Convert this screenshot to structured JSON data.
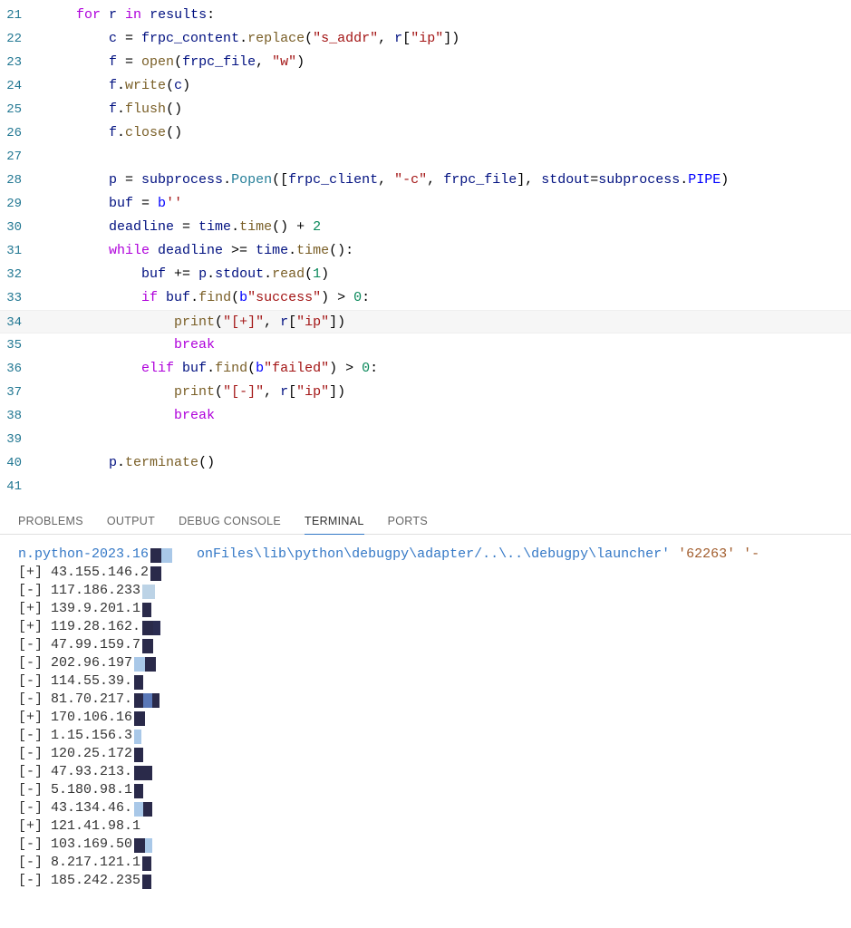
{
  "editor": {
    "highlighted_line": 34,
    "lines": [
      {
        "n": 21,
        "indent": 1,
        "tokens": [
          {
            "t": "for ",
            "c": "tok-kw"
          },
          {
            "t": "r ",
            "c": "tok-var"
          },
          {
            "t": "in ",
            "c": "tok-kw"
          },
          {
            "t": "results",
            "c": "tok-var"
          },
          {
            "t": ":",
            "c": "tok-op"
          }
        ]
      },
      {
        "n": 22,
        "indent": 2,
        "tokens": [
          {
            "t": "c ",
            "c": "tok-var"
          },
          {
            "t": "= ",
            "c": "tok-op"
          },
          {
            "t": "frpc_content",
            "c": "tok-var"
          },
          {
            "t": ".",
            "c": "tok-op"
          },
          {
            "t": "replace",
            "c": "tok-func"
          },
          {
            "t": "(",
            "c": "tok-op"
          },
          {
            "t": "\"s_addr\"",
            "c": "tok-str"
          },
          {
            "t": ", ",
            "c": "tok-op"
          },
          {
            "t": "r",
            "c": "tok-var"
          },
          {
            "t": "[",
            "c": "tok-op"
          },
          {
            "t": "\"ip\"",
            "c": "tok-str"
          },
          {
            "t": "])",
            "c": "tok-op"
          }
        ]
      },
      {
        "n": 23,
        "indent": 2,
        "tokens": [
          {
            "t": "f ",
            "c": "tok-var"
          },
          {
            "t": "= ",
            "c": "tok-op"
          },
          {
            "t": "open",
            "c": "tok-func"
          },
          {
            "t": "(",
            "c": "tok-op"
          },
          {
            "t": "frpc_file",
            "c": "tok-var"
          },
          {
            "t": ", ",
            "c": "tok-op"
          },
          {
            "t": "\"w\"",
            "c": "tok-str"
          },
          {
            "t": ")",
            "c": "tok-op"
          }
        ]
      },
      {
        "n": 24,
        "indent": 2,
        "tokens": [
          {
            "t": "f",
            "c": "tok-var"
          },
          {
            "t": ".",
            "c": "tok-op"
          },
          {
            "t": "write",
            "c": "tok-func"
          },
          {
            "t": "(",
            "c": "tok-op"
          },
          {
            "t": "c",
            "c": "tok-var"
          },
          {
            "t": ")",
            "c": "tok-op"
          }
        ]
      },
      {
        "n": 25,
        "indent": 2,
        "tokens": [
          {
            "t": "f",
            "c": "tok-var"
          },
          {
            "t": ".",
            "c": "tok-op"
          },
          {
            "t": "flush",
            "c": "tok-func"
          },
          {
            "t": "()",
            "c": "tok-op"
          }
        ]
      },
      {
        "n": 26,
        "indent": 2,
        "tokens": [
          {
            "t": "f",
            "c": "tok-var"
          },
          {
            "t": ".",
            "c": "tok-op"
          },
          {
            "t": "close",
            "c": "tok-func"
          },
          {
            "t": "()",
            "c": "tok-op"
          }
        ]
      },
      {
        "n": 27,
        "indent": 2,
        "tokens": []
      },
      {
        "n": 28,
        "indent": 2,
        "tokens": [
          {
            "t": "p ",
            "c": "tok-var"
          },
          {
            "t": "= ",
            "c": "tok-op"
          },
          {
            "t": "subprocess",
            "c": "tok-var"
          },
          {
            "t": ".",
            "c": "tok-op"
          },
          {
            "t": "Popen",
            "c": "tok-class"
          },
          {
            "t": "([",
            "c": "tok-op"
          },
          {
            "t": "frpc_client",
            "c": "tok-var"
          },
          {
            "t": ", ",
            "c": "tok-op"
          },
          {
            "t": "\"-c\"",
            "c": "tok-str"
          },
          {
            "t": ", ",
            "c": "tok-op"
          },
          {
            "t": "frpc_file",
            "c": "tok-var"
          },
          {
            "t": "], ",
            "c": "tok-op"
          },
          {
            "t": "stdout",
            "c": "tok-var"
          },
          {
            "t": "=",
            "c": "tok-op"
          },
          {
            "t": "subprocess",
            "c": "tok-var"
          },
          {
            "t": ".",
            "c": "tok-op"
          },
          {
            "t": "PIPE",
            "c": "tok-const"
          },
          {
            "t": ")",
            "c": "tok-op"
          }
        ]
      },
      {
        "n": 29,
        "indent": 2,
        "tokens": [
          {
            "t": "buf ",
            "c": "tok-var"
          },
          {
            "t": "= ",
            "c": "tok-op"
          },
          {
            "t": "b",
            "c": "tok-const"
          },
          {
            "t": "''",
            "c": "tok-str"
          }
        ]
      },
      {
        "n": 30,
        "indent": 2,
        "tokens": [
          {
            "t": "deadline ",
            "c": "tok-var"
          },
          {
            "t": "= ",
            "c": "tok-op"
          },
          {
            "t": "time",
            "c": "tok-var"
          },
          {
            "t": ".",
            "c": "tok-op"
          },
          {
            "t": "time",
            "c": "tok-func"
          },
          {
            "t": "() + ",
            "c": "tok-op"
          },
          {
            "t": "2",
            "c": "tok-num"
          }
        ]
      },
      {
        "n": 31,
        "indent": 2,
        "tokens": [
          {
            "t": "while ",
            "c": "tok-kw"
          },
          {
            "t": "deadline ",
            "c": "tok-var"
          },
          {
            "t": ">= ",
            "c": "tok-op"
          },
          {
            "t": "time",
            "c": "tok-var"
          },
          {
            "t": ".",
            "c": "tok-op"
          },
          {
            "t": "time",
            "c": "tok-func"
          },
          {
            "t": "():",
            "c": "tok-op"
          }
        ]
      },
      {
        "n": 32,
        "indent": 3,
        "tokens": [
          {
            "t": "buf ",
            "c": "tok-var"
          },
          {
            "t": "+= ",
            "c": "tok-op"
          },
          {
            "t": "p",
            "c": "tok-var"
          },
          {
            "t": ".",
            "c": "tok-op"
          },
          {
            "t": "stdout",
            "c": "tok-var"
          },
          {
            "t": ".",
            "c": "tok-op"
          },
          {
            "t": "read",
            "c": "tok-func"
          },
          {
            "t": "(",
            "c": "tok-op"
          },
          {
            "t": "1",
            "c": "tok-num"
          },
          {
            "t": ")",
            "c": "tok-op"
          }
        ]
      },
      {
        "n": 33,
        "indent": 3,
        "tokens": [
          {
            "t": "if ",
            "c": "tok-kw"
          },
          {
            "t": "buf",
            "c": "tok-var"
          },
          {
            "t": ".",
            "c": "tok-op"
          },
          {
            "t": "find",
            "c": "tok-func"
          },
          {
            "t": "(",
            "c": "tok-op"
          },
          {
            "t": "b",
            "c": "tok-const"
          },
          {
            "t": "\"success\"",
            "c": "tok-str"
          },
          {
            "t": ") > ",
            "c": "tok-op"
          },
          {
            "t": "0",
            "c": "tok-num"
          },
          {
            "t": ":",
            "c": "tok-op"
          }
        ]
      },
      {
        "n": 34,
        "indent": 4,
        "tokens": [
          {
            "t": "print",
            "c": "tok-func"
          },
          {
            "t": "(",
            "c": "tok-op"
          },
          {
            "t": "\"[+]\"",
            "c": "tok-str"
          },
          {
            "t": ", ",
            "c": "tok-op"
          },
          {
            "t": "r",
            "c": "tok-var"
          },
          {
            "t": "[",
            "c": "tok-op"
          },
          {
            "t": "\"ip\"",
            "c": "tok-str"
          },
          {
            "t": "])",
            "c": "tok-op"
          }
        ]
      },
      {
        "n": 35,
        "indent": 4,
        "tokens": [
          {
            "t": "break",
            "c": "tok-kw"
          }
        ]
      },
      {
        "n": 36,
        "indent": 3,
        "tokens": [
          {
            "t": "elif ",
            "c": "tok-kw"
          },
          {
            "t": "buf",
            "c": "tok-var"
          },
          {
            "t": ".",
            "c": "tok-op"
          },
          {
            "t": "find",
            "c": "tok-func"
          },
          {
            "t": "(",
            "c": "tok-op"
          },
          {
            "t": "b",
            "c": "tok-const"
          },
          {
            "t": "\"failed\"",
            "c": "tok-str"
          },
          {
            "t": ") > ",
            "c": "tok-op"
          },
          {
            "t": "0",
            "c": "tok-num"
          },
          {
            "t": ":",
            "c": "tok-op"
          }
        ]
      },
      {
        "n": 37,
        "indent": 4,
        "tokens": [
          {
            "t": "print",
            "c": "tok-func"
          },
          {
            "t": "(",
            "c": "tok-op"
          },
          {
            "t": "\"[-]\"",
            "c": "tok-str"
          },
          {
            "t": ", ",
            "c": "tok-op"
          },
          {
            "t": "r",
            "c": "tok-var"
          },
          {
            "t": "[",
            "c": "tok-op"
          },
          {
            "t": "\"ip\"",
            "c": "tok-str"
          },
          {
            "t": "])",
            "c": "tok-op"
          }
        ]
      },
      {
        "n": 38,
        "indent": 4,
        "tokens": [
          {
            "t": "break",
            "c": "tok-kw"
          }
        ]
      },
      {
        "n": 39,
        "indent": 2,
        "tokens": []
      },
      {
        "n": 40,
        "indent": 2,
        "tokens": [
          {
            "t": "p",
            "c": "tok-var"
          },
          {
            "t": ".",
            "c": "tok-op"
          },
          {
            "t": "terminate",
            "c": "tok-func"
          },
          {
            "t": "()",
            "c": "tok-op"
          }
        ]
      },
      {
        "n": 41,
        "indent": 0,
        "tokens": []
      }
    ]
  },
  "panel": {
    "tabs": [
      {
        "label": "PROBLEMS",
        "active": false
      },
      {
        "label": "OUTPUT",
        "active": false
      },
      {
        "label": "DEBUG CONSOLE",
        "active": false
      },
      {
        "label": "TERMINAL",
        "active": true
      },
      {
        "label": "PORTS",
        "active": false
      }
    ]
  },
  "terminal": {
    "header_segments": [
      {
        "text": "n.python-2023.16",
        "c": "term-path"
      },
      {
        "text": "onFiles\\lib\\python\\debugpy\\adapter/..\\..\\debugpy\\launcher' ",
        "c": "term-path"
      },
      {
        "text": "'62263' '-",
        "c": "term-lit"
      }
    ],
    "header_redact": [
      {
        "w": 12,
        "c": "#2a2a4a"
      },
      {
        "w": 12,
        "c": "#a9c8e8"
      }
    ],
    "rows": [
      {
        "status": "[+]",
        "ip": "43.155.146.2",
        "redact": [
          {
            "w": 12,
            "c": "#2a2a4a"
          }
        ]
      },
      {
        "status": "[-]",
        "ip": "117.186.233",
        "redact": [
          {
            "w": 14,
            "c": "#bcd3e6"
          }
        ]
      },
      {
        "status": "[+]",
        "ip": "139.9.201.1",
        "redact": [
          {
            "w": 10,
            "c": "#2a2a4a"
          }
        ]
      },
      {
        "status": "[+]",
        "ip": "119.28.162.",
        "redact": [
          {
            "w": 12,
            "c": "#2a2a4a"
          },
          {
            "w": 8,
            "c": "#2b2d52"
          }
        ]
      },
      {
        "status": "[-]",
        "ip": "47.99.159.7",
        "redact": [
          {
            "w": 12,
            "c": "#2a2a4a"
          }
        ]
      },
      {
        "status": "[-]",
        "ip": "202.96.197",
        "redact": [
          {
            "w": 12,
            "c": "#a9c8e8"
          },
          {
            "w": 12,
            "c": "#2a2a4a"
          }
        ]
      },
      {
        "status": "[-]",
        "ip": "114.55.39.",
        "redact": [
          {
            "w": 10,
            "c": "#2a2a4a"
          }
        ]
      },
      {
        "status": "[-]",
        "ip": "81.70.217.",
        "redact": [
          {
            "w": 10,
            "c": "#2a2a4a"
          },
          {
            "w": 10,
            "c": "#5a78b8"
          },
          {
            "w": 8,
            "c": "#2a2a4a"
          }
        ]
      },
      {
        "status": "[+]",
        "ip": "170.106.16",
        "redact": [
          {
            "w": 12,
            "c": "#2a2a4a"
          }
        ]
      },
      {
        "status": "[-]",
        "ip": "1.15.156.3",
        "redact": [
          {
            "w": 8,
            "c": "#a9c8e8"
          }
        ]
      },
      {
        "status": "[-]",
        "ip": "120.25.172",
        "redact": [
          {
            "w": 10,
            "c": "#2a2a4a"
          }
        ]
      },
      {
        "status": "[-]",
        "ip": "47.93.213.",
        "redact": [
          {
            "w": 12,
            "c": "#2a2a4a"
          },
          {
            "w": 8,
            "c": "#2a2a4a"
          }
        ]
      },
      {
        "status": "[-]",
        "ip": "5.180.98.1",
        "redact": [
          {
            "w": 10,
            "c": "#2a2a4a"
          }
        ]
      },
      {
        "status": "[-]",
        "ip": "43.134.46.",
        "redact": [
          {
            "w": 10,
            "c": "#a9c8e8"
          },
          {
            "w": 10,
            "c": "#2a2a4a"
          }
        ]
      },
      {
        "status": "[+]",
        "ip": "121.41.98.1",
        "redact": []
      },
      {
        "status": "[-]",
        "ip": "103.169.50",
        "redact": [
          {
            "w": 12,
            "c": "#2a2a4a"
          },
          {
            "w": 8,
            "c": "#a9c8e8"
          }
        ]
      },
      {
        "status": "[-]",
        "ip": "8.217.121.1",
        "redact": [
          {
            "w": 10,
            "c": "#2a2a4a"
          }
        ]
      },
      {
        "status": "[-]",
        "ip": "185.242.235",
        "redact": [
          {
            "w": 10,
            "c": "#2a2a4a"
          }
        ]
      }
    ]
  }
}
